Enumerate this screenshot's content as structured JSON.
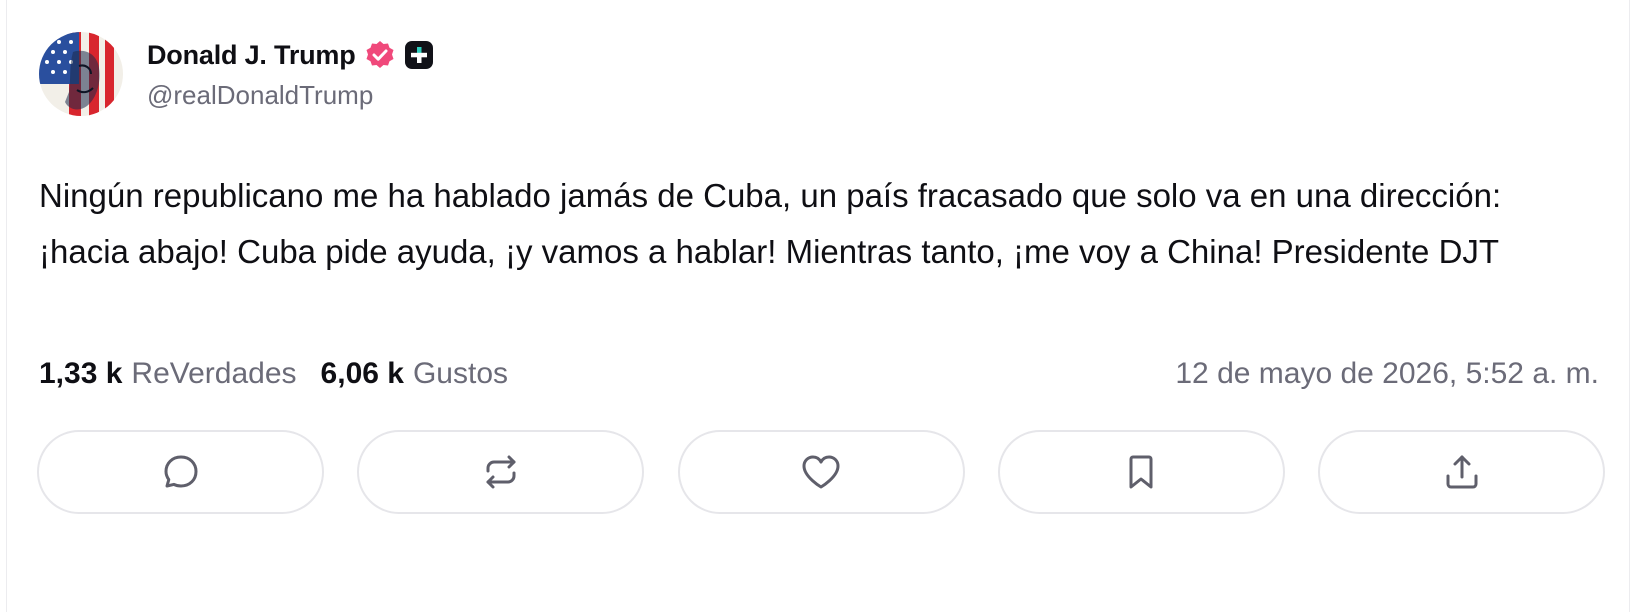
{
  "post": {
    "author": {
      "display_name": "Donald J. Trump",
      "handle": "@realDonaldTrump",
      "verified_badge": "verified-check-icon",
      "plus_badge": "plus-badge-icon",
      "badge_color": "#f0497b"
    },
    "text": "Ningún republicano me ha hablado jamás de Cuba, un país fracasado que solo va en una dirección: ¡hacia abajo! Cuba pide ayuda, ¡y vamos a hablar! Mientras tanto, ¡me voy a China! Presidente DJT",
    "stats": {
      "reverdades_count": "1,33 k",
      "reverdades_label": "ReVerdades",
      "likes_count": "6,06 k",
      "likes_label": "Gustos"
    },
    "timestamp": "12 de mayo de 2026, 5:52 a. m."
  },
  "actions": [
    {
      "icon": "reply-icon"
    },
    {
      "icon": "repost-icon"
    },
    {
      "icon": "heart-icon"
    },
    {
      "icon": "bookmark-icon"
    },
    {
      "icon": "share-icon"
    }
  ],
  "colors": {
    "text_primary": "#0f0f14",
    "text_secondary": "#6b6b78",
    "border": "#e6e6ea",
    "icon": "#5f5f6b"
  }
}
